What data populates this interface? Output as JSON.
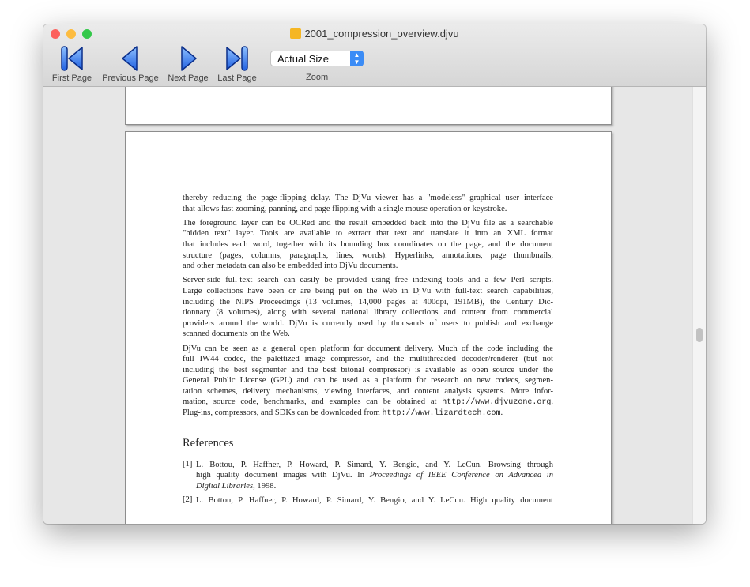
{
  "window": {
    "title": "2001_compression_overview.djvu",
    "doc_icon": "djvu-document-icon"
  },
  "toolbar": {
    "first": "First Page",
    "previous": "Previous Page",
    "next": "Next Page",
    "last": "Last Page",
    "zoom_value": "Actual Size",
    "zoom_label": "Zoom"
  },
  "colors": {
    "accent": "#3b8cf6",
    "close": "#fc605c",
    "minimize": "#fdbc40",
    "zoom": "#34c84a",
    "nav_icon": "#2f6de1"
  },
  "page": {
    "paragraphs": [
      [
        "thereby reducing the page-flipping delay.  The DjVu viewer has a \"modeless\" graphical user interface",
        "that allows fast zooming, panning, and page flipping with a single mouse operation or keystroke."
      ],
      [
        "The foreground layer can be OCRed and the result embedded back into the DjVu file as a searchable",
        "\"hidden text\" layer.  Tools are available to extract that text and translate it into an XML format",
        "that includes each word, together with its bounding box coordinates on the page, and the document",
        "structure (pages, columns, paragraphs, lines, words).  Hyperlinks, annotations, page thumbnails,",
        "and other metadata can also be embedded into DjVu documents."
      ],
      [
        "Server-side full-text search can easily be provided using free indexing tools and a few Perl scripts.",
        "Large collections have been or are being put on the Web in DjVu with full-text search capabilities,",
        "including the NIPS Proceedings (13 volumes, 14,000 pages at 400dpi, 191MB), the Century Dic-",
        "tionnary (8 volumes), along with several national library collections and content from commercial",
        "providers around the world. DjVu is currently used by thousands of users to publish and exchange",
        "scanned documents on the Web."
      ],
      [
        "DjVu can be seen as a general open platform for document delivery.  Much of the code including the",
        "full IW44 codec, the palettized image compressor, and the multithreaded decoder/renderer (but not",
        "including the best segmenter and the best bitonal compressor) is available as open source under the",
        "General Public License (GPL) and can be used as a platform for research on new codecs, segmen-",
        "tation schemes, delivery mechanisms, viewing interfaces, and content analysis systems.  More infor-"
      ]
    ],
    "p4_line6": "mation, source code, benchmarks, and examples can be obtained at",
    "url1": "http://www.djvuzone.org",
    "p4_line7": "Plug-ins, compressors, and SDKs can be downloaded from",
    "url2": "http://www.lizardtech.com",
    "references_heading": "References",
    "references": [
      {
        "num": "[1]",
        "authors": "L. Bottou, P. Haffner, P. Howard, P. Simard, Y. Bengio, and Y. LeCun.  Browsing through",
        "line2": "high quality document images with DjVu. In ",
        "italic2": "Proceedings of IEEE Conference on Advanced in",
        "italic3": "Digital Libraries",
        "year": ", 1998."
      },
      {
        "num": "[2]",
        "authors": "L. Bottou, P. Haffner, P. Howard, P. Simard, Y. Bengio, and Y. LeCun. High quality document"
      }
    ]
  }
}
